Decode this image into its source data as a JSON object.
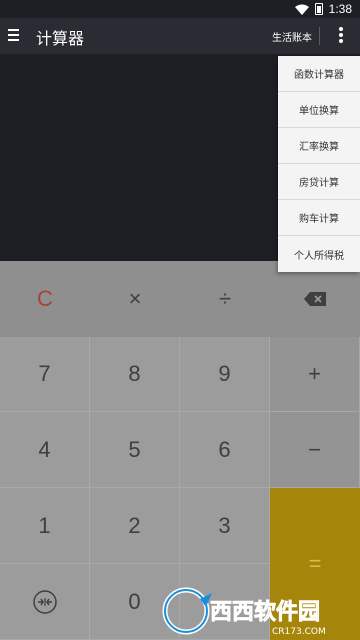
{
  "status_bar": {
    "time": "1:38",
    "icons": [
      "wifi-icon",
      "battery-icon"
    ]
  },
  "app_bar": {
    "title": "计算器",
    "ledger_label": "生活账本",
    "menu_icon": "hamburger-menu-icon",
    "overflow_icon": "overflow-vertical-icon"
  },
  "menu": {
    "items": [
      {
        "label": "函数计算器"
      },
      {
        "label": "单位换算"
      },
      {
        "label": "汇率换算"
      },
      {
        "label": "房贷计算"
      },
      {
        "label": "购车计算"
      },
      {
        "label": "个人所得税"
      }
    ]
  },
  "keypad": {
    "clear": "C",
    "multiply": "×",
    "divide": "÷",
    "backspace_icon": "backspace-icon",
    "k7": "7",
    "k8": "8",
    "k9": "9",
    "plus": "+",
    "k4": "4",
    "k5": "5",
    "k6": "6",
    "minus": "−",
    "k1": "1",
    "k2": "2",
    "k3": "3",
    "equals": "=",
    "k0": "0",
    "convert_icon": "convert-arrows-icon"
  },
  "watermark": {
    "brand": "西西软件园",
    "url": "CR173.COM"
  },
  "colors": {
    "display_bg": "#1e1f25",
    "appbar_bg": "#2b2c33",
    "equals_bg": "#a6860a",
    "clear_color": "#a8423c"
  }
}
